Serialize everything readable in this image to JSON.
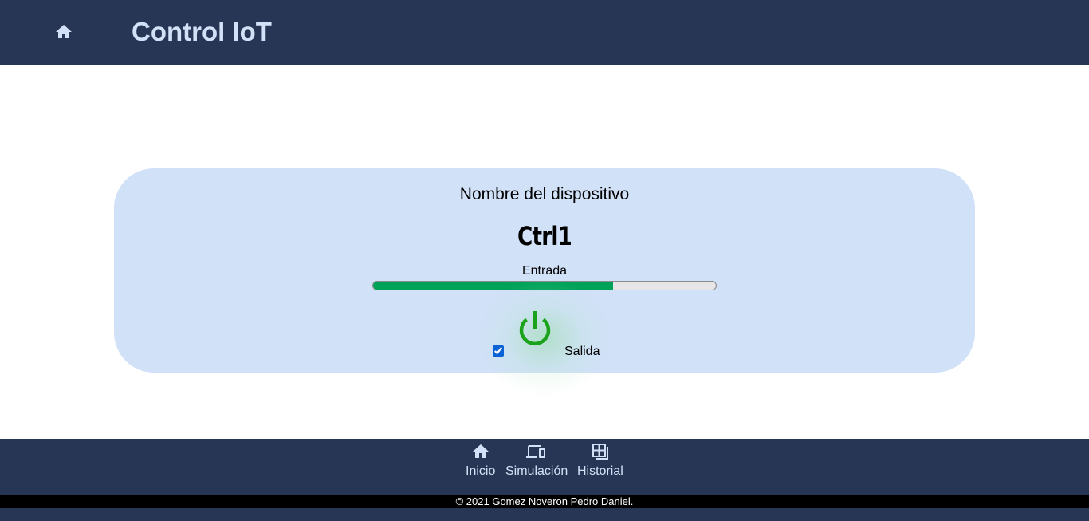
{
  "header": {
    "title": "Control IoT",
    "home_icon": "home-icon"
  },
  "device": {
    "label": "Nombre del dispositivo",
    "name": "Ctrl1",
    "input_label": "Entrada",
    "input_level": 0.7,
    "output_label": "Salida",
    "output_checked": true,
    "power_icon": "power-icon",
    "power_color": "#1aa31a"
  },
  "nav": {
    "items": [
      {
        "label": "Inicio",
        "icon": "home-icon"
      },
      {
        "label": "Simulación",
        "icon": "devices-icon"
      },
      {
        "label": "Historial",
        "icon": "dashboard-icon"
      }
    ]
  },
  "footer": {
    "copyright": "© 2021 Gomez Noveron Pedro Daniel."
  },
  "colors": {
    "header_bg": "#283655",
    "card_bg": "#d1e1f8",
    "progress_fill": "#00a25a",
    "text_light": "#d3e1f8"
  }
}
